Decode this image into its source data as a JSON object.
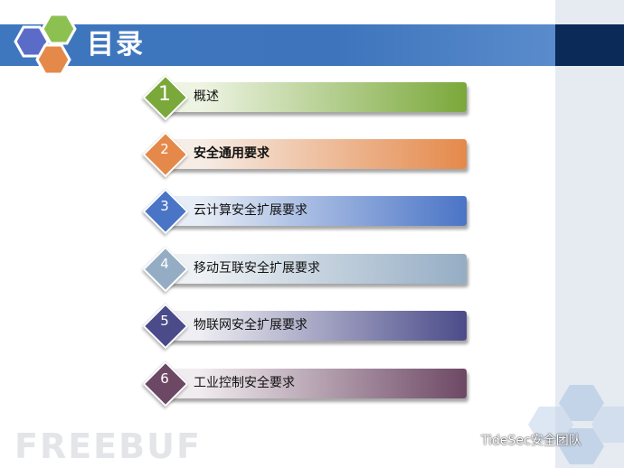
{
  "title": "目录",
  "menu": [
    {
      "num": "1",
      "label": "概述",
      "color_dark": "#7aa83a",
      "color_light": "#eef4e4"
    },
    {
      "num": "2",
      "label": "安全通用要求",
      "color_dark": "#e5894a",
      "color_light": "#f6ede7"
    },
    {
      "num": "3",
      "label": "云计算安全扩展要求",
      "color_dark": "#4a74c6",
      "color_light": "#e7edf6"
    },
    {
      "num": "4",
      "label": "移动互联安全扩展要求",
      "color_dark": "#95adc4",
      "color_light": "#eef2f5"
    },
    {
      "num": "5",
      "label": "物联网安全扩展要求",
      "color_dark": "#4b4b8a",
      "color_light": "#eeeef3"
    },
    {
      "num": "6",
      "label": "工业控制安全要求",
      "color_dark": "#6d4865",
      "color_light": "#f1ecef"
    }
  ],
  "watermark": "FREEBUF",
  "footer": {
    "credit": "TideSec安全团队"
  },
  "colors": {
    "title_bar": "#3d74bc",
    "title_bar_dark": "#0b2a57",
    "hex_blue": "#5b6cc8",
    "hex_green": "#8cc152",
    "hex_orange": "#e5894a"
  }
}
